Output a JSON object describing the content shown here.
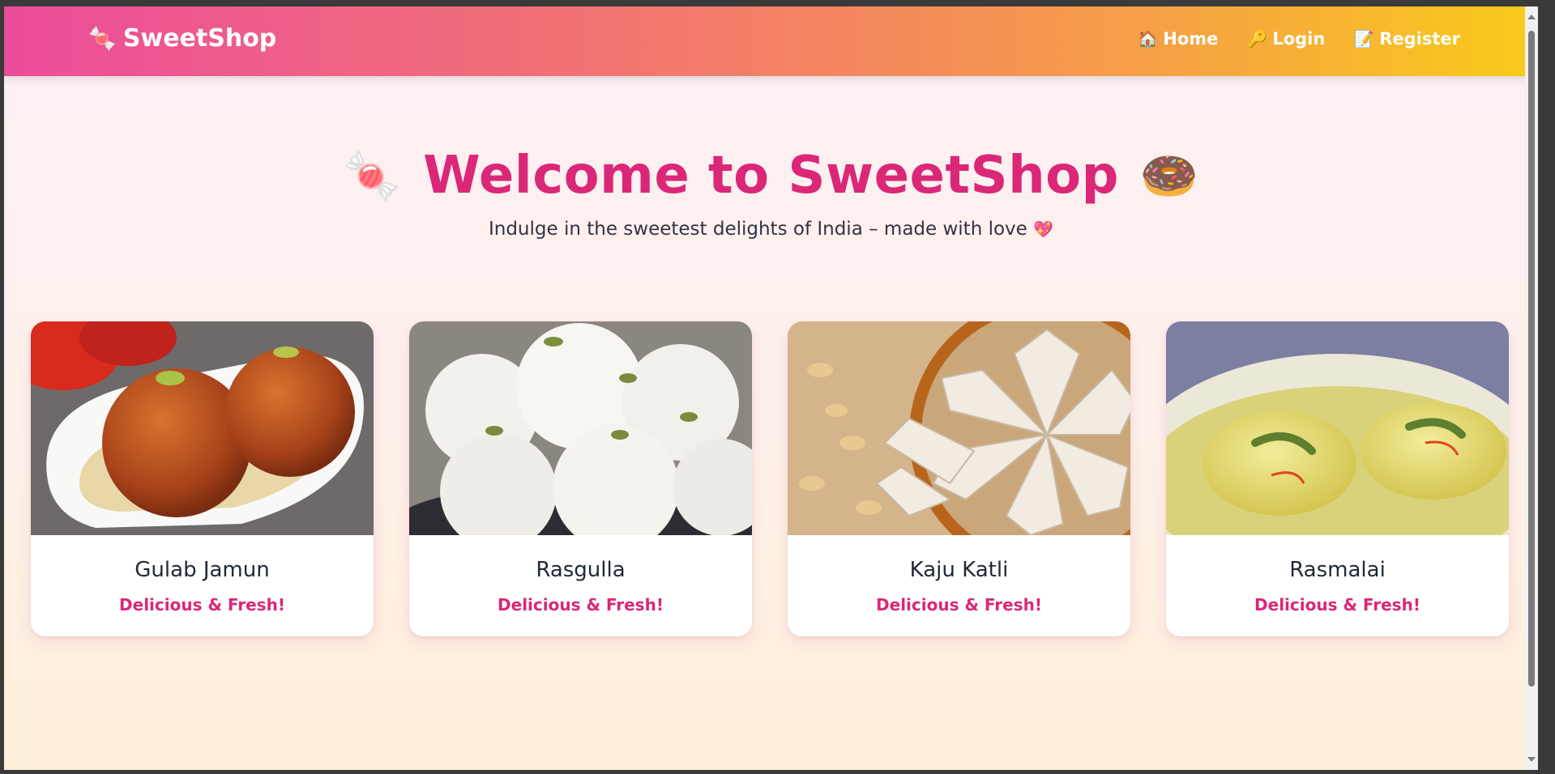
{
  "navbar": {
    "brand_icon": "🍬",
    "brand_name": "SweetShop",
    "links": [
      {
        "icon": "🏠",
        "label": "Home"
      },
      {
        "icon": "🔑",
        "label": "Login"
      },
      {
        "icon": "📝",
        "label": "Register"
      }
    ]
  },
  "hero": {
    "left_icon": "🍬",
    "title": "Welcome to SweetShop",
    "right_icon": "🍩",
    "subtitle": "Indulge in the sweetest delights of India – made with love",
    "subtitle_icon": "💖"
  },
  "products": [
    {
      "name": "Gulab Jamun",
      "tagline": "Delicious & Fresh!"
    },
    {
      "name": "Rasgulla",
      "tagline": "Delicious & Fresh!"
    },
    {
      "name": "Kaju Katli",
      "tagline": "Delicious & Fresh!"
    },
    {
      "name": "Rasmalai",
      "tagline": "Delicious & Fresh!"
    }
  ],
  "colors": {
    "accent": "#db2777",
    "navbar_start": "#ec4c9b",
    "navbar_end": "#f9cb19"
  }
}
